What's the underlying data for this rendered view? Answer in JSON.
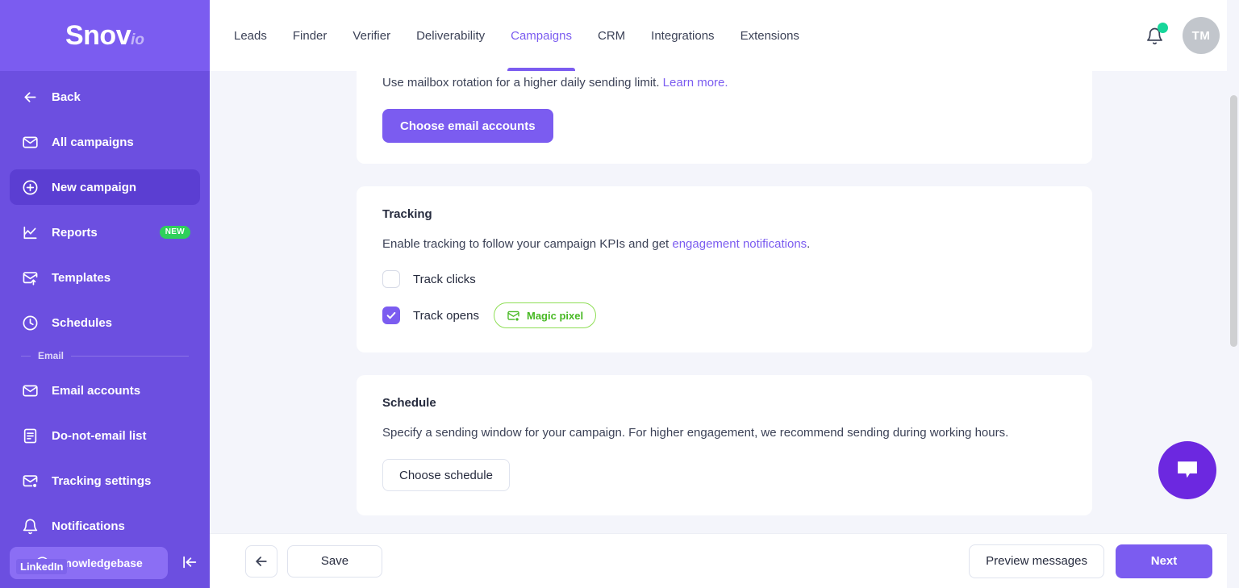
{
  "sidebar": {
    "logo": {
      "brand": "Snov",
      "suffix": "io"
    },
    "items": [
      {
        "label": "Back",
        "icon": "arrow-left-icon",
        "active": false,
        "badge": null
      },
      {
        "label": "All campaigns",
        "icon": "envelope-icon",
        "active": false,
        "badge": null
      },
      {
        "label": "New campaign",
        "icon": "plus-circle-icon",
        "active": true,
        "badge": null
      },
      {
        "label": "Reports",
        "icon": "chart-icon",
        "active": false,
        "badge": "NEW"
      },
      {
        "label": "Templates",
        "icon": "envelope-up-icon",
        "active": false,
        "badge": null
      },
      {
        "label": "Schedules",
        "icon": "clock-icon",
        "active": false,
        "badge": null
      }
    ],
    "section_email": "Email",
    "email_items": [
      {
        "label": "Email accounts",
        "icon": "envelope-icon"
      },
      {
        "label": "Do-not-email list",
        "icon": "document-icon"
      },
      {
        "label": "Tracking settings",
        "icon": "envelope-dot-icon"
      },
      {
        "label": "Notifications",
        "icon": "bell-icon"
      }
    ],
    "knowledgebase": "Knowledgebase",
    "linkedin_chip": "LinkedIn"
  },
  "topbar": {
    "tabs": [
      {
        "label": "Leads",
        "active": false
      },
      {
        "label": "Finder",
        "active": false
      },
      {
        "label": "Verifier",
        "active": false
      },
      {
        "label": "Deliverability",
        "active": false
      },
      {
        "label": "Campaigns",
        "active": true
      },
      {
        "label": "CRM",
        "active": false
      },
      {
        "label": "Integrations",
        "active": false
      },
      {
        "label": "Extensions",
        "active": false
      }
    ],
    "avatar_initials": "TM"
  },
  "mailbox_card": {
    "text": "Use mailbox rotation for a higher daily sending limit.",
    "link": "Learn more.",
    "button": "Choose email accounts"
  },
  "tracking_card": {
    "title": "Tracking",
    "text_before": "Enable tracking to follow your campaign KPIs and get",
    "link": "engagement notifications",
    "text_after": ".",
    "track_clicks": {
      "label": "Track clicks",
      "checked": false
    },
    "track_opens": {
      "label": "Track opens",
      "checked": true
    },
    "magic_pixel": "Magic pixel"
  },
  "schedule_card": {
    "title": "Schedule",
    "text": "Specify a sending window for your campaign. For higher engagement, we recommend sending during working hours.",
    "button": "Choose schedule"
  },
  "bottombar": {
    "back_icon": "arrow-left-icon",
    "save": "Save",
    "preview": "Preview messages",
    "next": "Next"
  },
  "colors": {
    "brand_purple": "#7b5cf0",
    "sidebar_purple": "#6c4fe0",
    "active_item": "#5b3ed2",
    "page_bg": "#f4f5fb",
    "green_badge": "#2fd05a",
    "magic_pixel_green": "#48b924",
    "notification_dot": "#17d69a",
    "chat_fab": "#6c28e0"
  }
}
